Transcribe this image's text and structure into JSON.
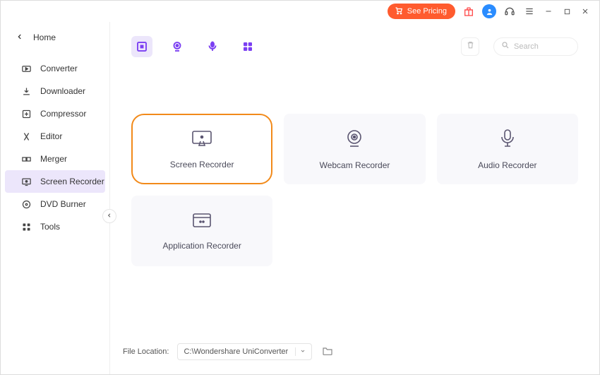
{
  "titlebar": {
    "pricing_label": "See Pricing"
  },
  "sidebar": {
    "home_label": "Home",
    "items": [
      {
        "label": "Converter"
      },
      {
        "label": "Downloader"
      },
      {
        "label": "Compressor"
      },
      {
        "label": "Editor"
      },
      {
        "label": "Merger"
      },
      {
        "label": "Screen Recorder"
      },
      {
        "label": "DVD Burner"
      },
      {
        "label": "Tools"
      }
    ]
  },
  "search": {
    "placeholder": "Search"
  },
  "cards": {
    "screen": "Screen Recorder",
    "webcam": "Webcam Recorder",
    "audio": "Audio Recorder",
    "application": "Application Recorder"
  },
  "footer": {
    "file_location_label": "File Location:",
    "file_location_value": "C:\\Wondershare UniConverter"
  }
}
